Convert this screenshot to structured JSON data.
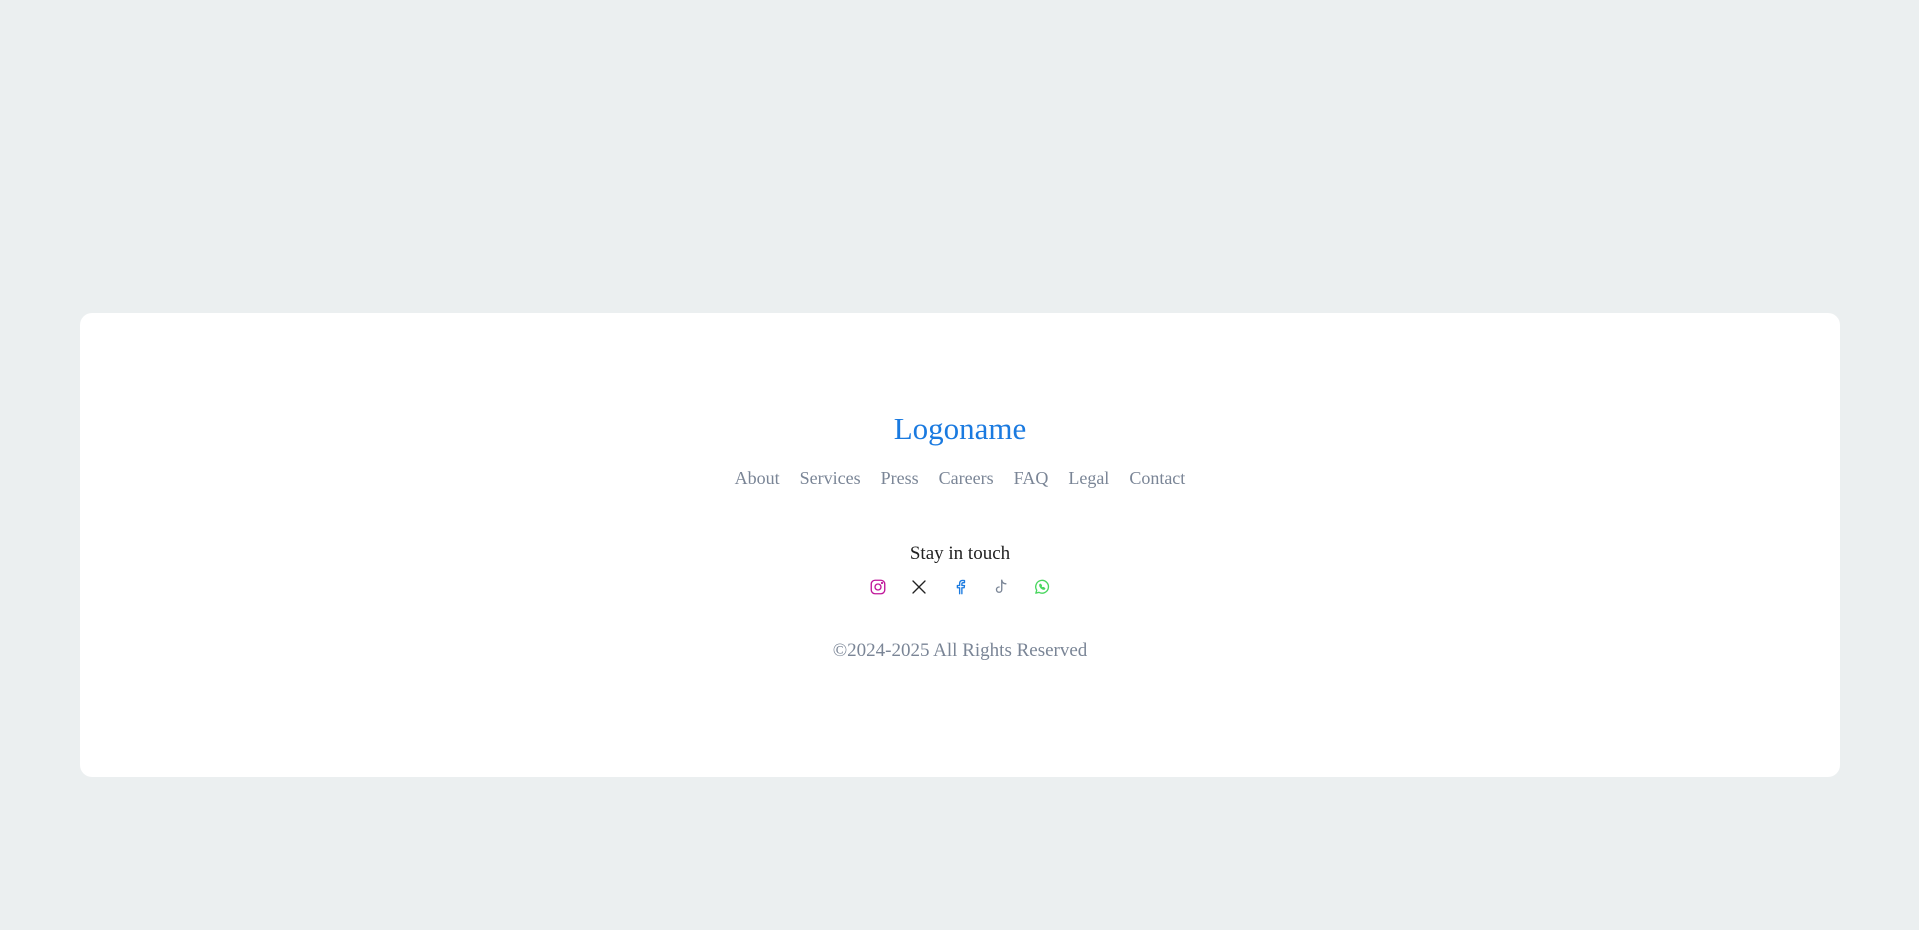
{
  "logo": {
    "text": "Logoname",
    "color": "#1a7ae0"
  },
  "nav": {
    "items": [
      {
        "label": "About"
      },
      {
        "label": "Services"
      },
      {
        "label": "Press"
      },
      {
        "label": "Careers"
      },
      {
        "label": "FAQ"
      },
      {
        "label": "Legal"
      },
      {
        "label": "Contact"
      }
    ]
  },
  "social": {
    "title": "Stay in touch",
    "icons": [
      {
        "name": "instagram-icon",
        "color": "#c0169a"
      },
      {
        "name": "x-icon",
        "color": "#222222"
      },
      {
        "name": "facebook-icon",
        "color": "#1a7ae0"
      },
      {
        "name": "tiktok-icon",
        "color": "#7a8596"
      },
      {
        "name": "whatsapp-icon",
        "color": "#49d65f"
      }
    ]
  },
  "footer": {
    "copyright": "©2024-2025 All Rights Reserved"
  }
}
